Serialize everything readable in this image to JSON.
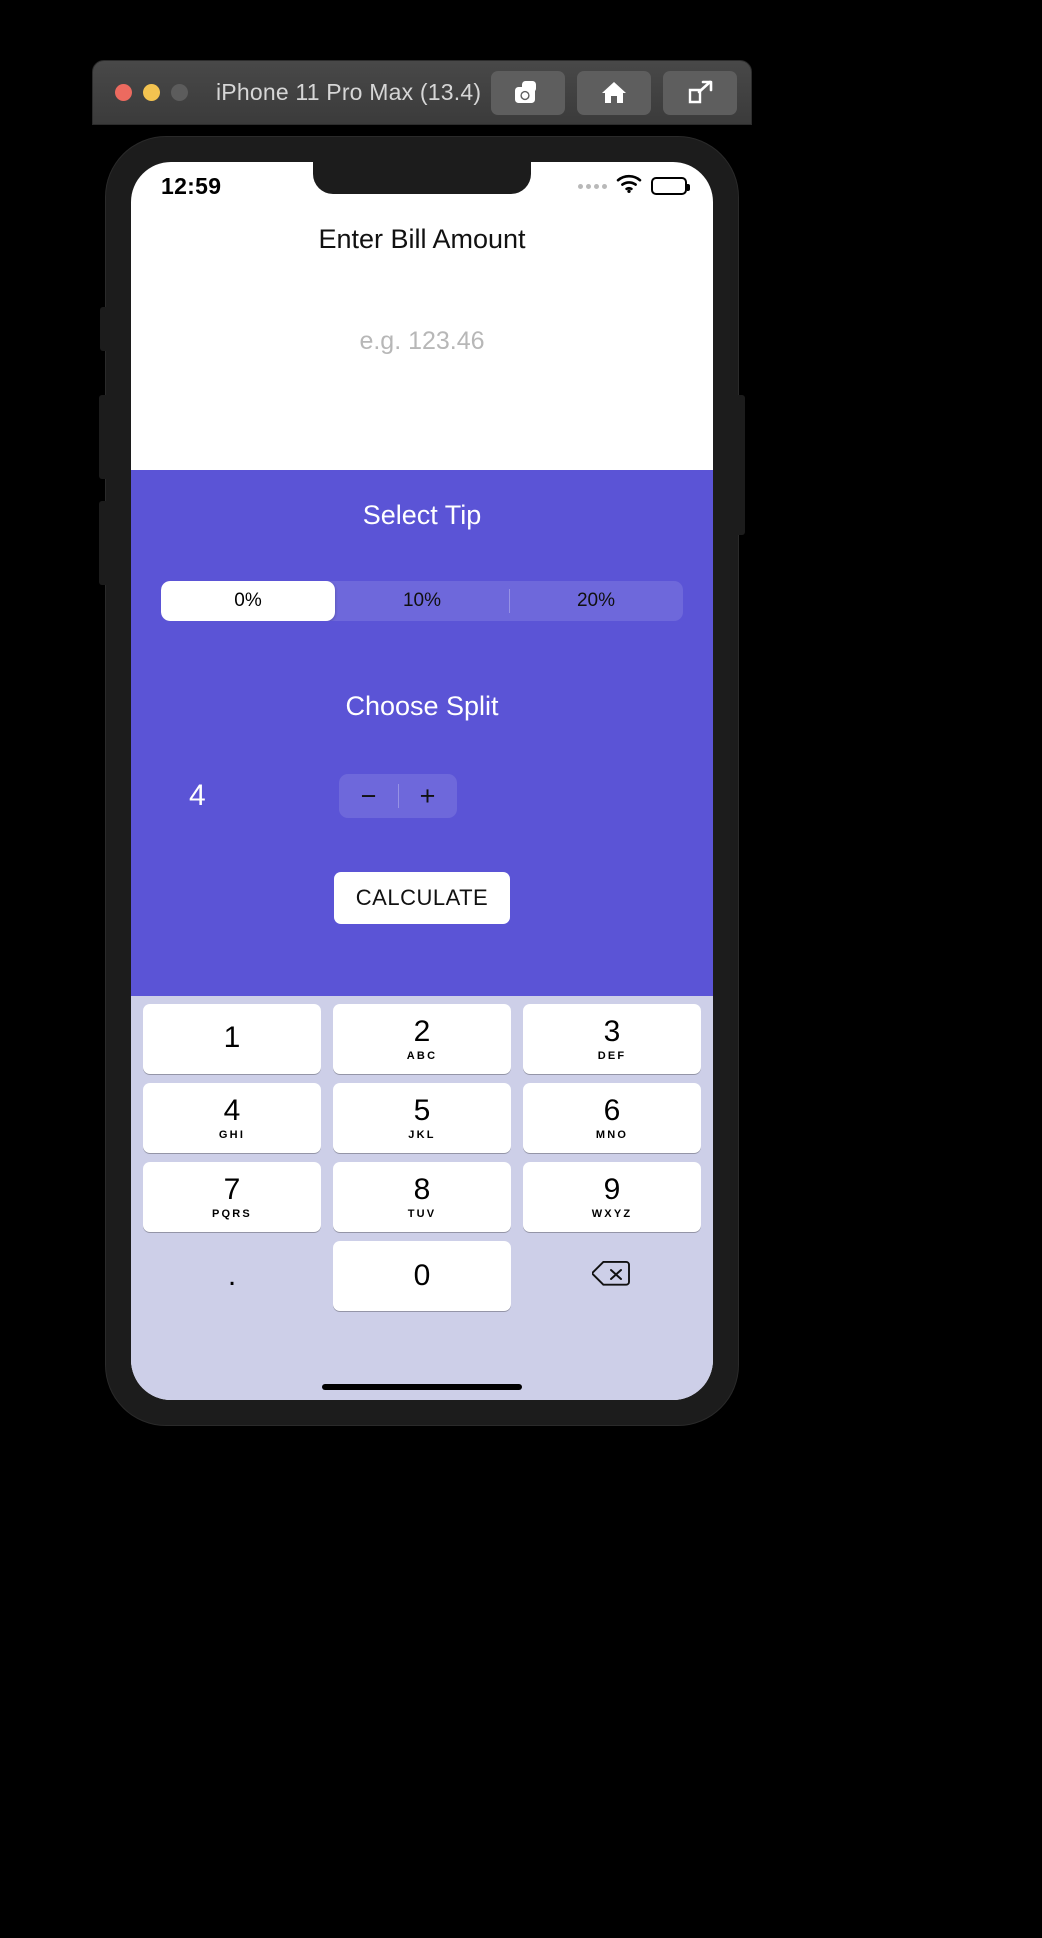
{
  "simulator": {
    "title": "iPhone 11 Pro Max (13.4)",
    "traffic_lights": [
      {
        "name": "close",
        "color": "#ec6a5f"
      },
      {
        "name": "minimize",
        "color": "#f3c350"
      },
      {
        "name": "zoom",
        "color": "#5c5c5c"
      }
    ],
    "toolbar_buttons": [
      {
        "icon": "screenshot-camera-icon"
      },
      {
        "icon": "home-icon"
      },
      {
        "icon": "rotate-share-icon"
      }
    ]
  },
  "status_bar": {
    "time": "12:59",
    "wifi_icon": "wifi-icon",
    "battery_icon": "battery-icon",
    "signal_icon": "signal-dots-icon"
  },
  "app": {
    "bill": {
      "title": "Enter Bill Amount",
      "value": "",
      "placeholder": "e.g. 123.46"
    },
    "tip": {
      "label": "Select Tip",
      "options": [
        "0%",
        "10%",
        "20%"
      ],
      "selected_index": 0
    },
    "split": {
      "label": "Choose Split",
      "count": "4",
      "decrement_label": "−",
      "increment_label": "+"
    },
    "calculate_label": "CALCULATE",
    "accent_color": "#5b54d6"
  },
  "keypad": {
    "rows": [
      [
        {
          "num": "1",
          "letters": ""
        },
        {
          "num": "2",
          "letters": "ABC"
        },
        {
          "num": "3",
          "letters": "DEF"
        }
      ],
      [
        {
          "num": "4",
          "letters": "GHI"
        },
        {
          "num": "5",
          "letters": "JKL"
        },
        {
          "num": "6",
          "letters": "MNO"
        }
      ],
      [
        {
          "num": "7",
          "letters": "PQRS"
        },
        {
          "num": "8",
          "letters": "TUV"
        },
        {
          "num": "9",
          "letters": "WXYZ"
        }
      ],
      [
        {
          "num": ".",
          "letters": ""
        },
        {
          "num": "0",
          "letters": ""
        },
        {
          "num": "",
          "letters": "",
          "icon": "backspace-icon"
        }
      ]
    ]
  }
}
